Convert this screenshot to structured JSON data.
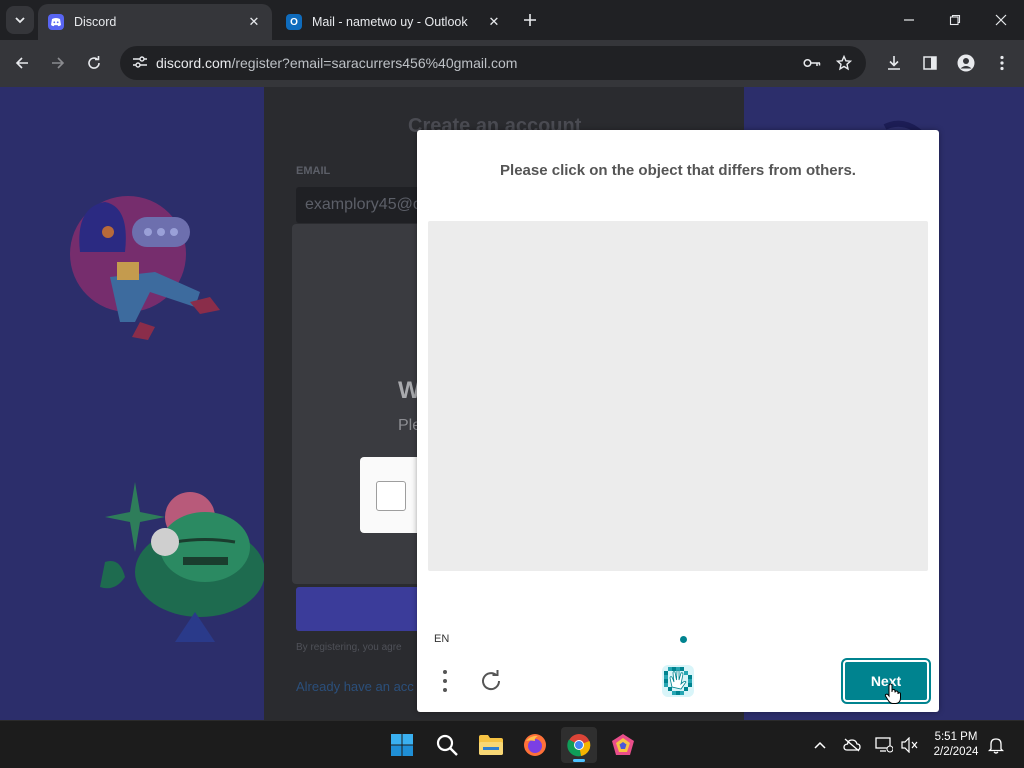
{
  "browser": {
    "tabs": [
      {
        "title": "Discord",
        "active": true,
        "icon": "discord-icon"
      },
      {
        "title": "Mail - nametwo uy - Outlook",
        "active": false,
        "icon": "outlook-icon"
      }
    ],
    "url_host": "discord.com",
    "url_path": "/register?email=saracurrers456%40gmail.com"
  },
  "background_page": {
    "title": "Create an account",
    "email_label": "EMAIL",
    "email_value": "examplory45@o",
    "verify_title": "W",
    "verify_subtitle": "Ple",
    "terms_text": "By registering, you agre",
    "login_link": "Already have an acc"
  },
  "captcha": {
    "prompt": "Please click on the object that differs from others.",
    "language": "EN",
    "next_label": "Next",
    "accent_color": "#00838f"
  },
  "taskbar": {
    "apps": [
      "windows-start-icon",
      "search-icon",
      "file-explorer-icon",
      "firefox-icon",
      "chrome-icon",
      "app-icon"
    ],
    "time": "5:51 PM",
    "date": "2/2/2024"
  }
}
